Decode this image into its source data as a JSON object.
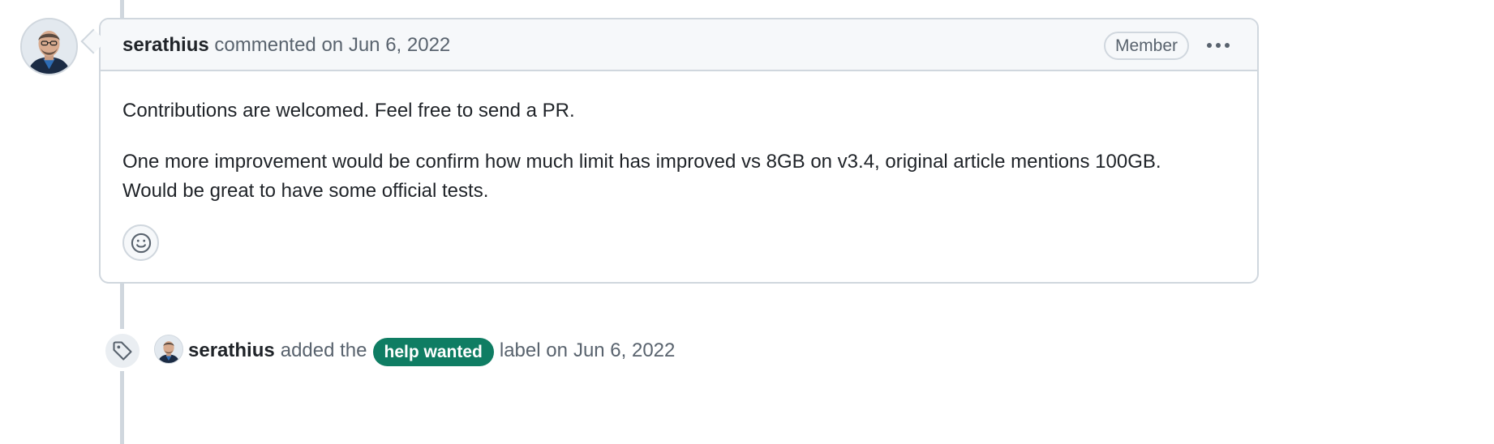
{
  "comment": {
    "author": "serathius",
    "action": "commented on",
    "date": "Jun 6, 2022",
    "role_badge": "Member",
    "body": {
      "paragraph1": "Contributions are welcomed. Feel free to send a PR.",
      "paragraph2_line1": "One more improvement would be confirm how much limit has improved vs 8GB on v3.4, original article mentions 100GB.",
      "paragraph2_line2": "Would be great to have some official tests."
    }
  },
  "event": {
    "author": "serathius",
    "action": "added the",
    "label": "help wanted",
    "suffix": "label on",
    "date": "Jun 6, 2022",
    "label_color": "#0f7d63"
  },
  "icons": {
    "more": "kebab-horizontal-icon",
    "reaction": "smiley-icon",
    "event": "tag-icon"
  },
  "colors": {
    "border": "#d0d7de",
    "header_bg": "#f6f8fa",
    "muted_text": "#59636e"
  }
}
